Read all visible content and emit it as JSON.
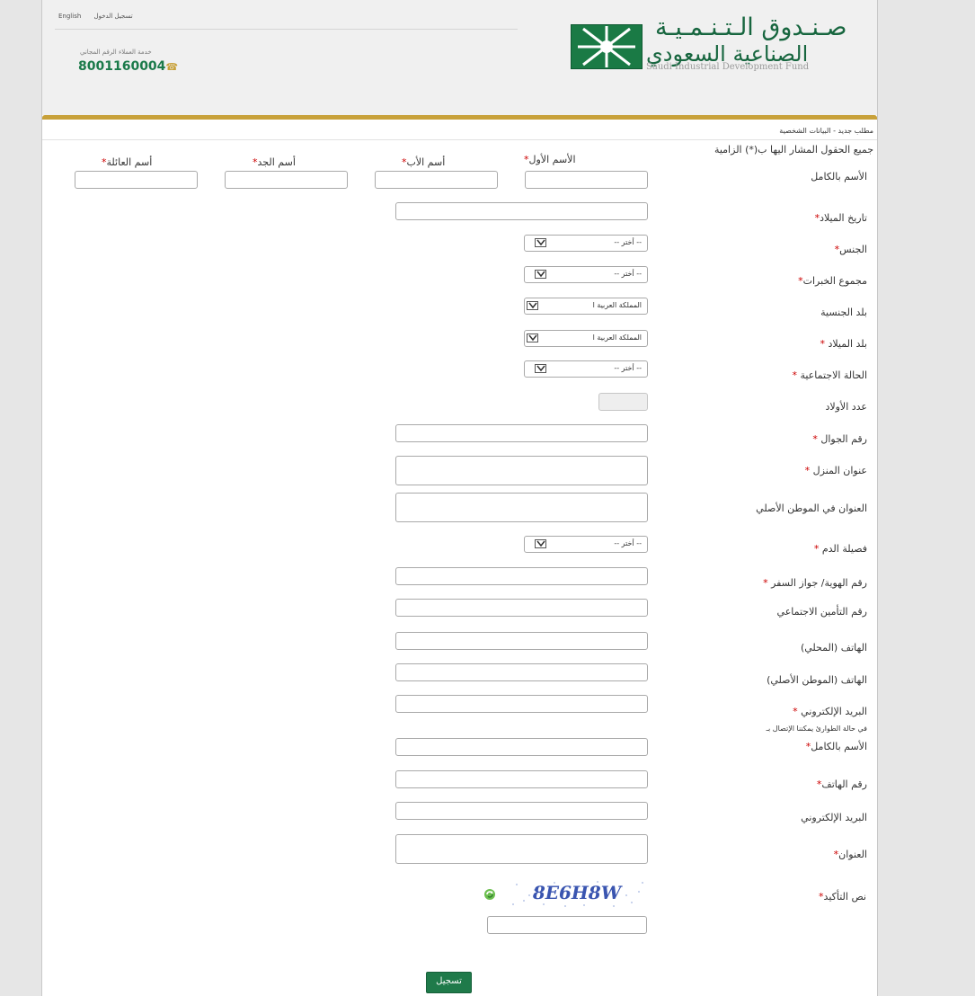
{
  "header": {
    "links": [
      "English",
      "تسجيل الدخول"
    ],
    "hotline_label": "خدمة العملاء الرقم المجاني",
    "hotline_number": "8001160004",
    "logo_ar_line1": "صـنـدوق الـتـنـمـيـة",
    "logo_ar_line2": "الصناعية السعودي",
    "logo_en": "Saudi Industrial Development Fund"
  },
  "breadcrumb": "مطلب جديد - البيانات الشخصية",
  "required_note": "جميع الحقول المشار اليها ب(*) الزامية",
  "name_columns": [
    "الأسم الأول",
    "أسم الأب",
    "أسم الجد",
    "أسم العائلة"
  ],
  "labels": {
    "full_name": "الأسم بالكامل",
    "birth_date": "تاريخ الميلاد",
    "gender": "الجنس",
    "experience": "مجموع الخبرات",
    "nationality": "بلد الجنسية",
    "birth_country": "بلد الميلاد",
    "marital_status": "الحالة الاجتماعية",
    "children": "عدد الأولاد",
    "mobile": "رقم الجوال",
    "home_address": "عنوان المنزل",
    "home_country_address": "العنوان في الموطن الأصلي",
    "blood_type": "فصيلة الدم",
    "id_number": "رقم الهوية/ جواز السفر",
    "social_insurance": "رقم التأمين الاجتماعي",
    "local_phone": "الهاتف (المحلي)",
    "home_phone": "الهاتف (الموطن الأصلي)",
    "email": "البريد الإلكتروني",
    "emergency_note": "في حالة الطوارئ يمكننا الإتصال بـ",
    "emergency_name": "الأسم بالكامل",
    "emergency_phone": "رقم الهاتف",
    "emergency_email": "البريد الإلكتروني",
    "emergency_address": "العنوان",
    "captcha": "نص التأكيد"
  },
  "selects": {
    "placeholder": "-- أختر --",
    "country_default": "المملكة العربية ا"
  },
  "captcha_text": "8E6H8W",
  "submit_label": "تسجيل",
  "colors": {
    "brand_green": "#1f7a4a",
    "gold": "#c8a13a",
    "required": "#cc0000"
  }
}
